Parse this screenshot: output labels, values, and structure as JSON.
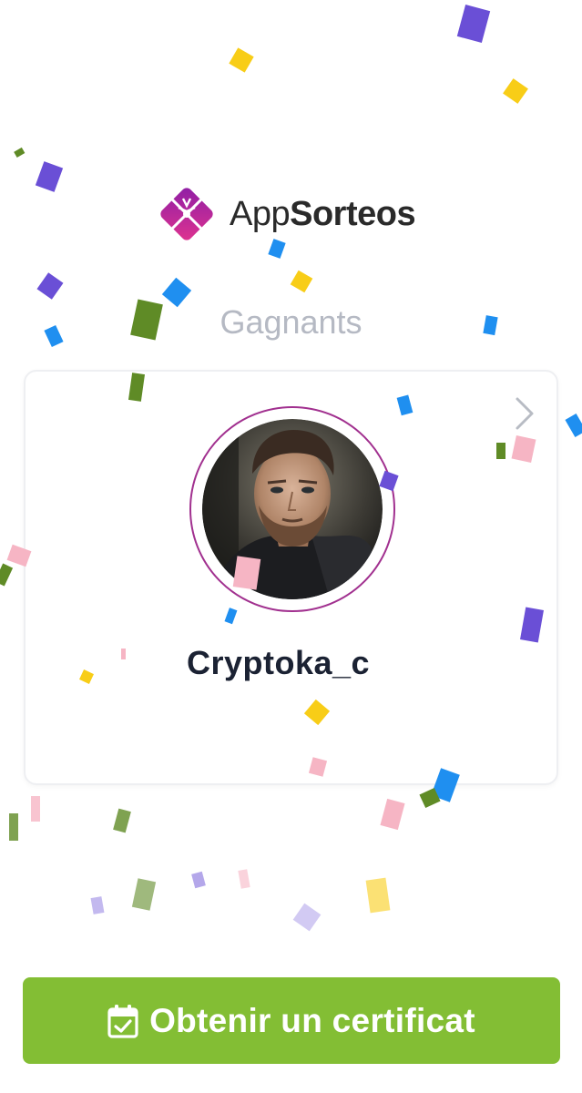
{
  "app": {
    "logo": {
      "name_light": "App",
      "name_bold": "Sorteos",
      "icon": "gift-icon"
    }
  },
  "heading": "Gagnants",
  "winner": {
    "username": "Cryptoka_c",
    "avatar": "avatar-photo",
    "chevron_icon": "chevron-right-icon"
  },
  "cta": {
    "label": "Obtenir un certificat",
    "icon": "calendar-check-icon"
  },
  "colors": {
    "brand_magenta": "#a1308f",
    "button_green": "#83be34",
    "heading_gray": "#b5b9c3",
    "name_dark": "#1b2233"
  },
  "confetti_colors": [
    "#6a4fd6",
    "#f8cd17",
    "#1f8ff0",
    "#f6b5c4",
    "#5f8b26"
  ]
}
